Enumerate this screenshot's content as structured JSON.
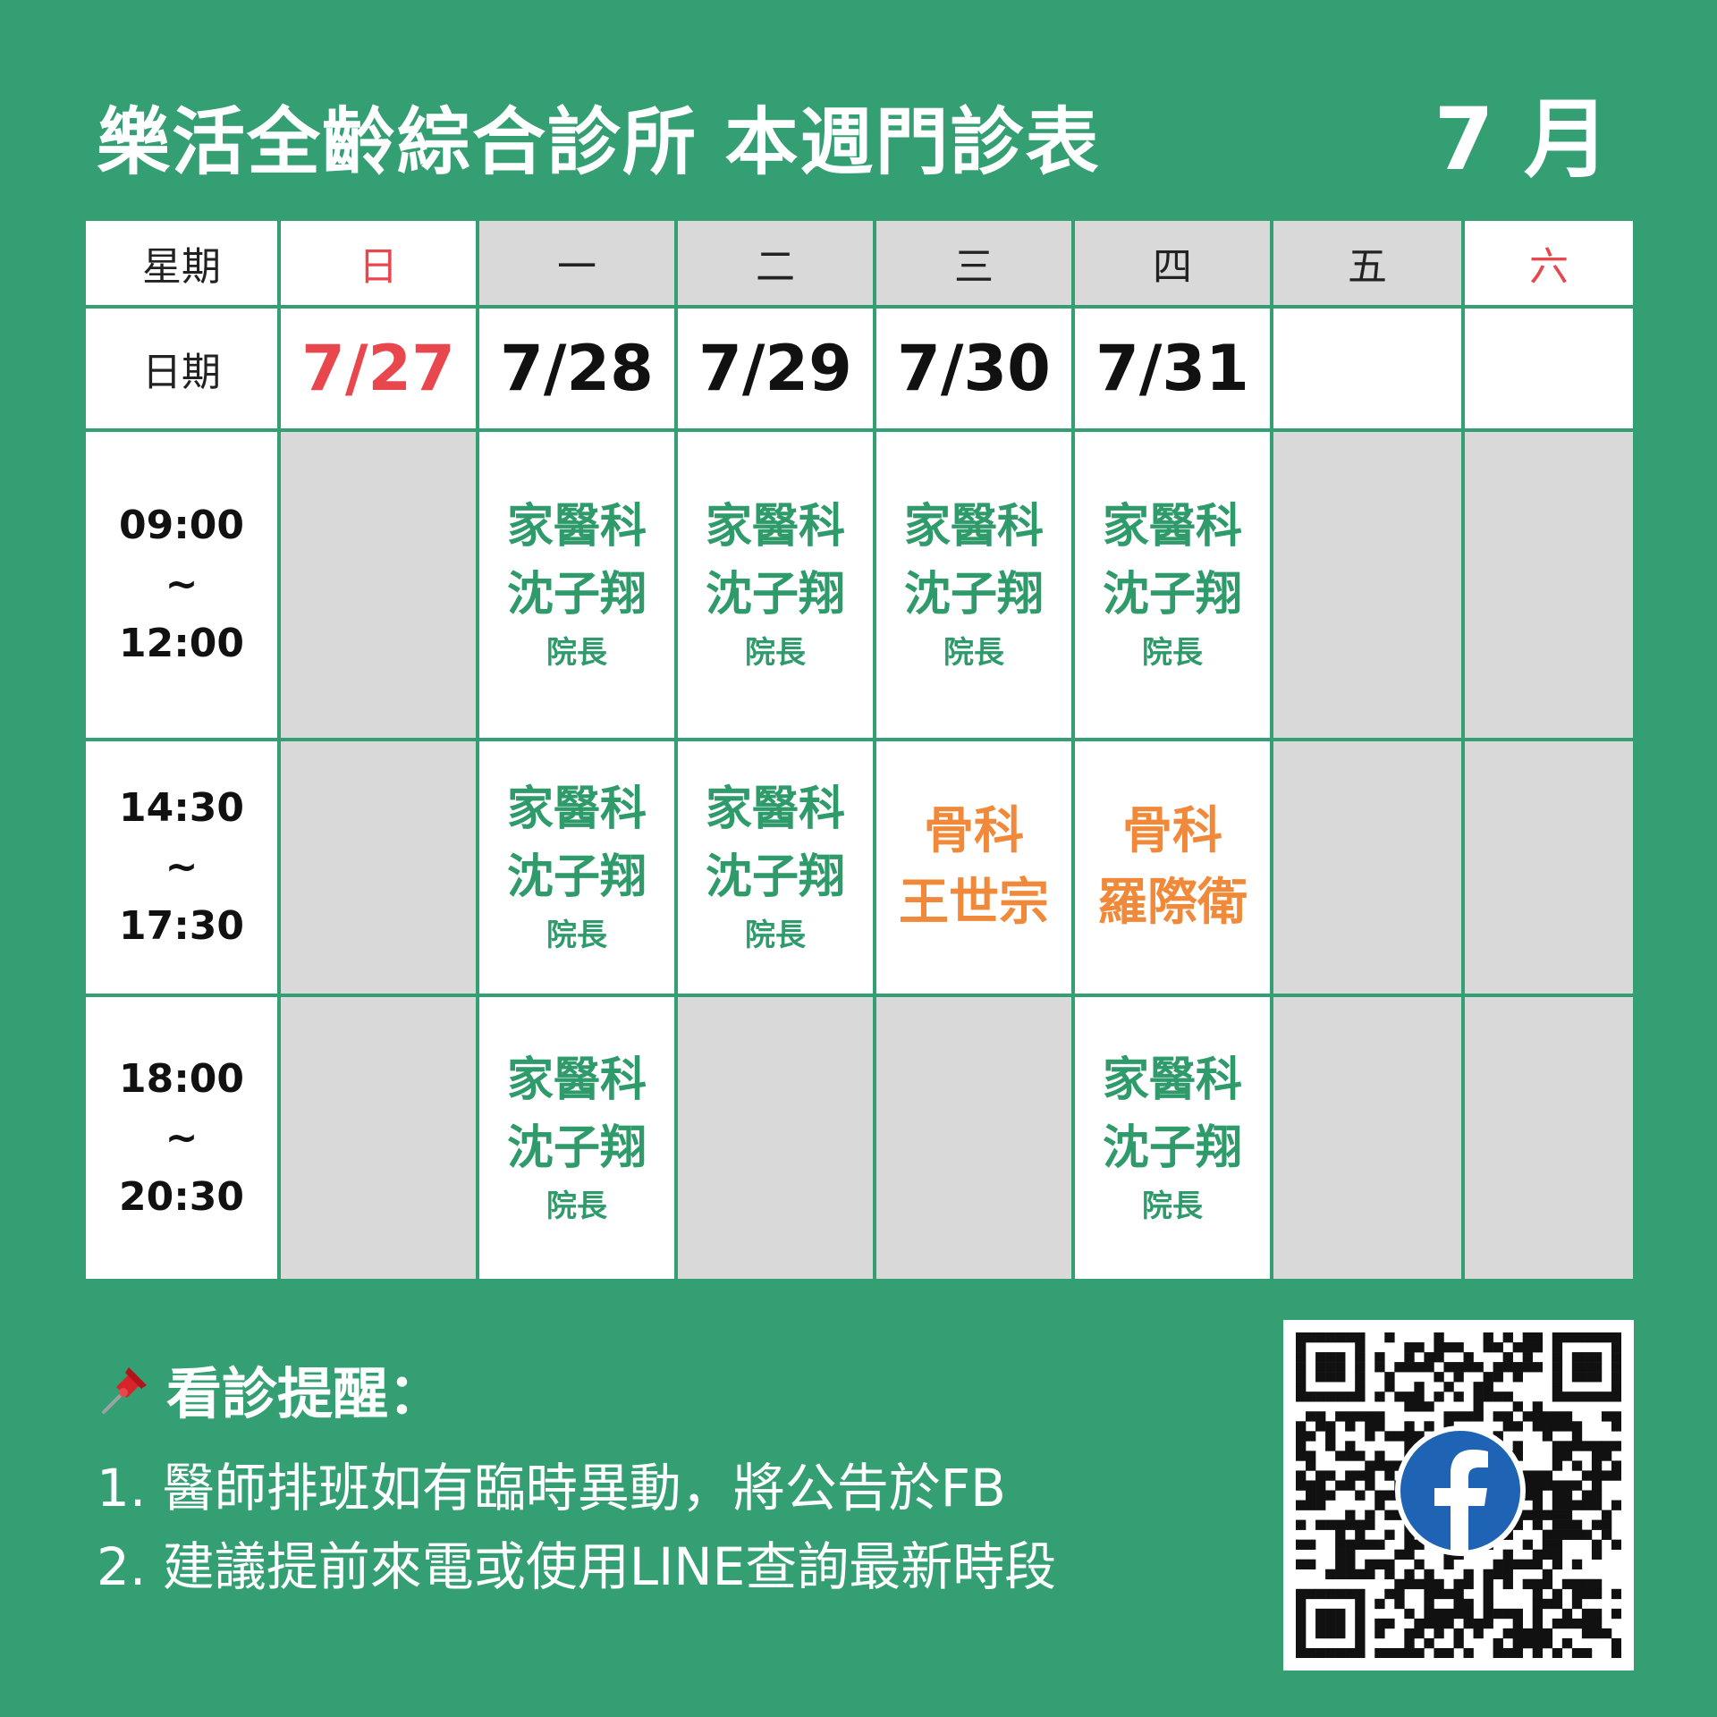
{
  "header": {
    "title": "樂活全齡綜合診所  本週門診表",
    "month": "7  月"
  },
  "table": {
    "weekday_label": "星期",
    "date_label": "日期",
    "weekdays": [
      "日",
      "一",
      "二",
      "三",
      "四",
      "五",
      "六"
    ],
    "dates": [
      "7/27",
      "7/28",
      "7/29",
      "7/30",
      "7/31",
      "",
      ""
    ],
    "slots": [
      {
        "start": "09:00",
        "sep": "~",
        "end": "12:00",
        "cells": [
          null,
          {
            "dept": "家醫科",
            "doctor": "沈子翔",
            "title": "院長",
            "color": "green"
          },
          {
            "dept": "家醫科",
            "doctor": "沈子翔",
            "title": "院長",
            "color": "green"
          },
          {
            "dept": "家醫科",
            "doctor": "沈子翔",
            "title": "院長",
            "color": "green"
          },
          {
            "dept": "家醫科",
            "doctor": "沈子翔",
            "title": "院長",
            "color": "green"
          },
          null,
          null
        ]
      },
      {
        "start": "14:30",
        "sep": "~",
        "end": "17:30",
        "cells": [
          null,
          {
            "dept": "家醫科",
            "doctor": "沈子翔",
            "title": "院長",
            "color": "green"
          },
          {
            "dept": "家醫科",
            "doctor": "沈子翔",
            "title": "院長",
            "color": "green"
          },
          {
            "dept": "骨科",
            "doctor": "王世宗",
            "title": "",
            "color": "orange"
          },
          {
            "dept": "骨科",
            "doctor": "羅際衛",
            "title": "",
            "color": "orange"
          },
          null,
          null
        ]
      },
      {
        "start": "18:00",
        "sep": "~",
        "end": "20:30",
        "cells": [
          null,
          {
            "dept": "家醫科",
            "doctor": "沈子翔",
            "title": "院長",
            "color": "green"
          },
          null,
          null,
          {
            "dept": "家醫科",
            "doctor": "沈子翔",
            "title": "院長",
            "color": "green"
          },
          null,
          null
        ]
      }
    ]
  },
  "notes": {
    "heading": "看診提醒：",
    "items": [
      "1. 醫師排班如有臨時異動，將公告於FB",
      "2. 建議提前來電或使用LINE查詢最新時段"
    ]
  },
  "icons": {
    "pin": "pushpin-icon",
    "qr": "qr-code",
    "facebook": "facebook-icon"
  },
  "colors": {
    "background": "#339f72",
    "green_text": "#2f9a6a",
    "orange_text": "#f08a3a",
    "weekend_red": "#e8474d",
    "closed_cell": "#d9d9d9"
  }
}
